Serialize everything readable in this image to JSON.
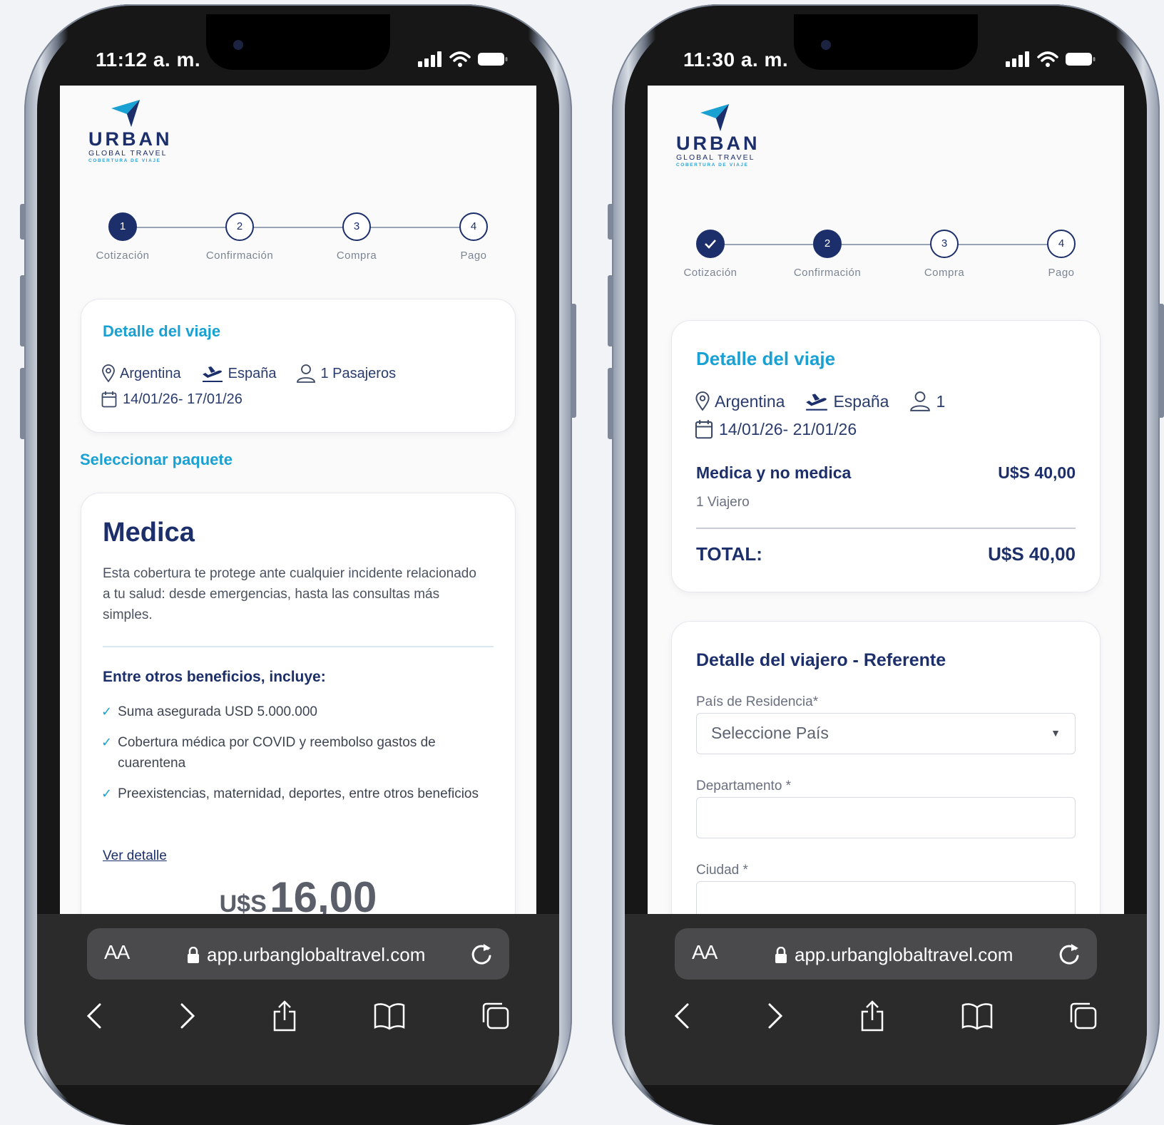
{
  "brand": {
    "name": "URBAN",
    "sub1": "GLOBAL TRAVEL",
    "sub2": "COBERTURA DE VIAJE",
    "primary_color": "#1c2f6b",
    "accent_color": "#1aa1d3"
  },
  "steps": [
    "Cotización",
    "Confirmación",
    "Compra",
    "Pago"
  ],
  "step_numbers": [
    "1",
    "2",
    "3",
    "4"
  ],
  "browser": {
    "aa": "AA",
    "url": "app.urbanglobaltravel.com",
    "icons": [
      "back-icon",
      "forward-icon",
      "share-icon",
      "bookmarks-icon",
      "tabs-icon"
    ]
  },
  "left": {
    "time": "11:12 a. m.",
    "current_step": 1,
    "trip": {
      "title": "Detalle del viaje",
      "origin": "Argentina",
      "destination": "España",
      "passengers": "1 Pasajeros",
      "dates": "14/01/26- 17/01/26"
    },
    "select_package": "Seleccionar paquete",
    "package": {
      "title": "Medica",
      "description": "Esta cobertura te protege ante cualquier incidente relacionado a tu salud: desde emergencias, hasta las consultas más simples.",
      "benefits_title": "Entre otros beneficios, incluye:",
      "benefits": [
        "Suma asegurada USD 5.000.000",
        "Cobertura médica por COVID y reembolso gastos de cuarentena",
        "Preexistencias, maternidad, deportes, entre otros beneficios"
      ],
      "detail_link": "Ver detalle",
      "currency": "U$S",
      "price": "16,00"
    }
  },
  "right": {
    "time": "11:30 a. m.",
    "current_step": 2,
    "trip": {
      "title": "Detalle del viaje",
      "origin": "Argentina",
      "destination": "España",
      "passengers": "1",
      "dates": "14/01/26- 21/01/26"
    },
    "summary": {
      "item_name": "Medica y no medica",
      "item_price": "U$S 40,00",
      "travelers": "1 Viajero",
      "total_label": "TOTAL:",
      "total_value": "U$S 40,00"
    },
    "traveler_form": {
      "title": "Detalle del viajero - Referente",
      "country_label": "País de Residencia*",
      "country_placeholder": "Seleccione País",
      "department_label": "Departamento *",
      "department_value": "",
      "city_label": "Ciudad *",
      "city_value": ""
    }
  }
}
